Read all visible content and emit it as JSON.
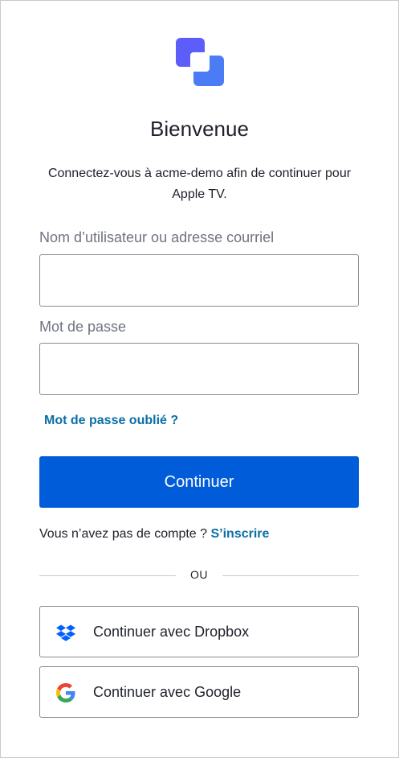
{
  "logo": {
    "icon": "acme-logo-icon",
    "colors": [
      "#5d5dfa",
      "#4b7cf5"
    ]
  },
  "header": {
    "title": "Bienvenue",
    "subtitle": "Connectez-vous à acme-demo afin de continuer pour Apple TV."
  },
  "form": {
    "username_label": "Nom d’utilisateur ou adresse courriel",
    "username_value": "",
    "password_label": "Mot de passe",
    "password_value": "",
    "forgot_password": "Mot de passe oublié ?",
    "continue_label": "Continuer"
  },
  "signup": {
    "prompt": "Vous n’avez pas de compte ?",
    "link": "S’inscrire"
  },
  "divider": {
    "text": "OU"
  },
  "social": [
    {
      "label": "Continuer avec Dropbox",
      "icon": "dropbox-icon"
    },
    {
      "label": "Continuer avec Google",
      "icon": "google-icon"
    }
  ],
  "colors": {
    "primary": "#005cd8",
    "link": "#0a6fa6",
    "border": "#898b90",
    "text": "#1e212a",
    "muted": "#6f7380"
  }
}
